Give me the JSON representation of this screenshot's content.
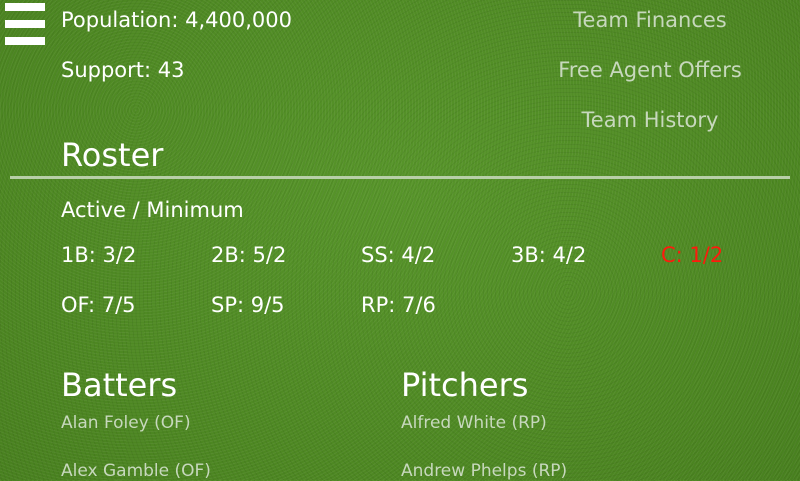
{
  "header": {
    "menu_icon": "hamburger-menu-icon",
    "population": "Population: 4,400,000",
    "support": "Support: 43"
  },
  "links": {
    "team_finances": "Team Finances",
    "free_agent_offers": "Free Agent Offers",
    "team_history": "Team History"
  },
  "roster": {
    "title": "Roster",
    "subtitle": "Active / Minimum",
    "positions": {
      "1B": "1B:  3/2",
      "2B": "2B:  5/2",
      "SS": "SS:  4/2",
      "3B": "3B:  4/2",
      "C": "C:  1/2",
      "OF": "OF:  7/5",
      "SP": "SP:  9/5",
      "RP": "RP:  7/6"
    },
    "warning_color": "#ff1a0d"
  },
  "batters": {
    "title": "Batters",
    "players": [
      "Alan Foley (OF)",
      "Alex Gamble (OF)"
    ]
  },
  "pitchers": {
    "title": "Pitchers",
    "players": [
      "Alfred White (RP)",
      "Andrew Phelps (RP)"
    ]
  }
}
